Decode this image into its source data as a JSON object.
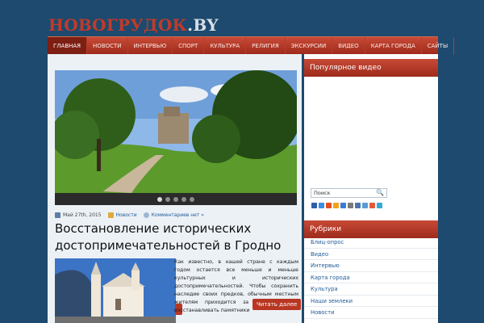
{
  "site": {
    "logo_main": "НОВОГРУДОК",
    "logo_domain": ".BY"
  },
  "nav": {
    "items": [
      {
        "label": "ГЛАВНАЯ",
        "active": true
      },
      {
        "label": "НОВОСТИ"
      },
      {
        "label": "ИНТЕРВЬЮ"
      },
      {
        "label": "СПОРТ"
      },
      {
        "label": "КУЛЬТУРА"
      },
      {
        "label": "РЕЛИГИЯ"
      },
      {
        "label": "ЭКСКУРСИИ"
      },
      {
        "label": "ВИДЕО"
      },
      {
        "label": "КАРТА ГОРОДА"
      },
      {
        "label": "САЙТЫ"
      }
    ]
  },
  "slider": {
    "total_slides": 5,
    "active_index": 0
  },
  "post": {
    "date": "Май 27th, 2015",
    "category": "Новости",
    "comments": "Комментариев нет »",
    "title": "Восстановление исторических достопримечательностей в Гродно",
    "excerpt": "Как известно, в нашей стране с каждым годом остается все меньше и меньше культурных и исторических достопримечательностей. Чтобы сохранить наследие своих предков, обычным местным жителям приходится за свои средства восстанавливать памятники",
    "read_more": "Читать далее"
  },
  "sidebar": {
    "popular_video_title": "Популярное видео",
    "search_value": "Поиск",
    "social_colors": [
      "#2f5fa7",
      "#3a8de0",
      "#e34e1b",
      "#f2a21b",
      "#3a7bd5",
      "#7a7a7a",
      "#4a76a8",
      "#5b9bd5",
      "#e05a3a",
      "#35a9d6"
    ],
    "rubrics_title": "Рубрики",
    "rubrics": [
      "Блиц-опрос",
      "Видео",
      "Интервью",
      "Карта города",
      "Культура",
      "Наши землеки",
      "Новости"
    ]
  }
}
